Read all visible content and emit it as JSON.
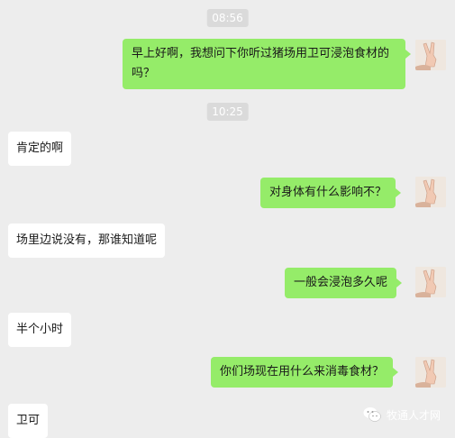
{
  "timestamps": [
    "08:56",
    "10:25"
  ],
  "messages": [
    {
      "side": "me",
      "text": "早上好啊，我想问下你听过猪场用卫可浸泡食材的吗？"
    },
    {
      "side": "them",
      "text": "肯定的啊"
    },
    {
      "side": "me",
      "text": "对身体有什么影响不？"
    },
    {
      "side": "them",
      "text": "场里边说没有，那谁知道呢"
    },
    {
      "side": "me",
      "text": "一般会浸泡多久呢"
    },
    {
      "side": "them",
      "text": "半个小时"
    },
    {
      "side": "me",
      "text": "你们场现在用什么来消毒食材？"
    },
    {
      "side": "them",
      "text": "卫可"
    }
  ],
  "watermark": {
    "text": "牧通人才网",
    "icon": "wechat-icon"
  },
  "colors": {
    "background": "#ededed",
    "my_bubble": "#95ec69",
    "their_bubble": "#ffffff",
    "timestamp_bg": "#dadada"
  }
}
